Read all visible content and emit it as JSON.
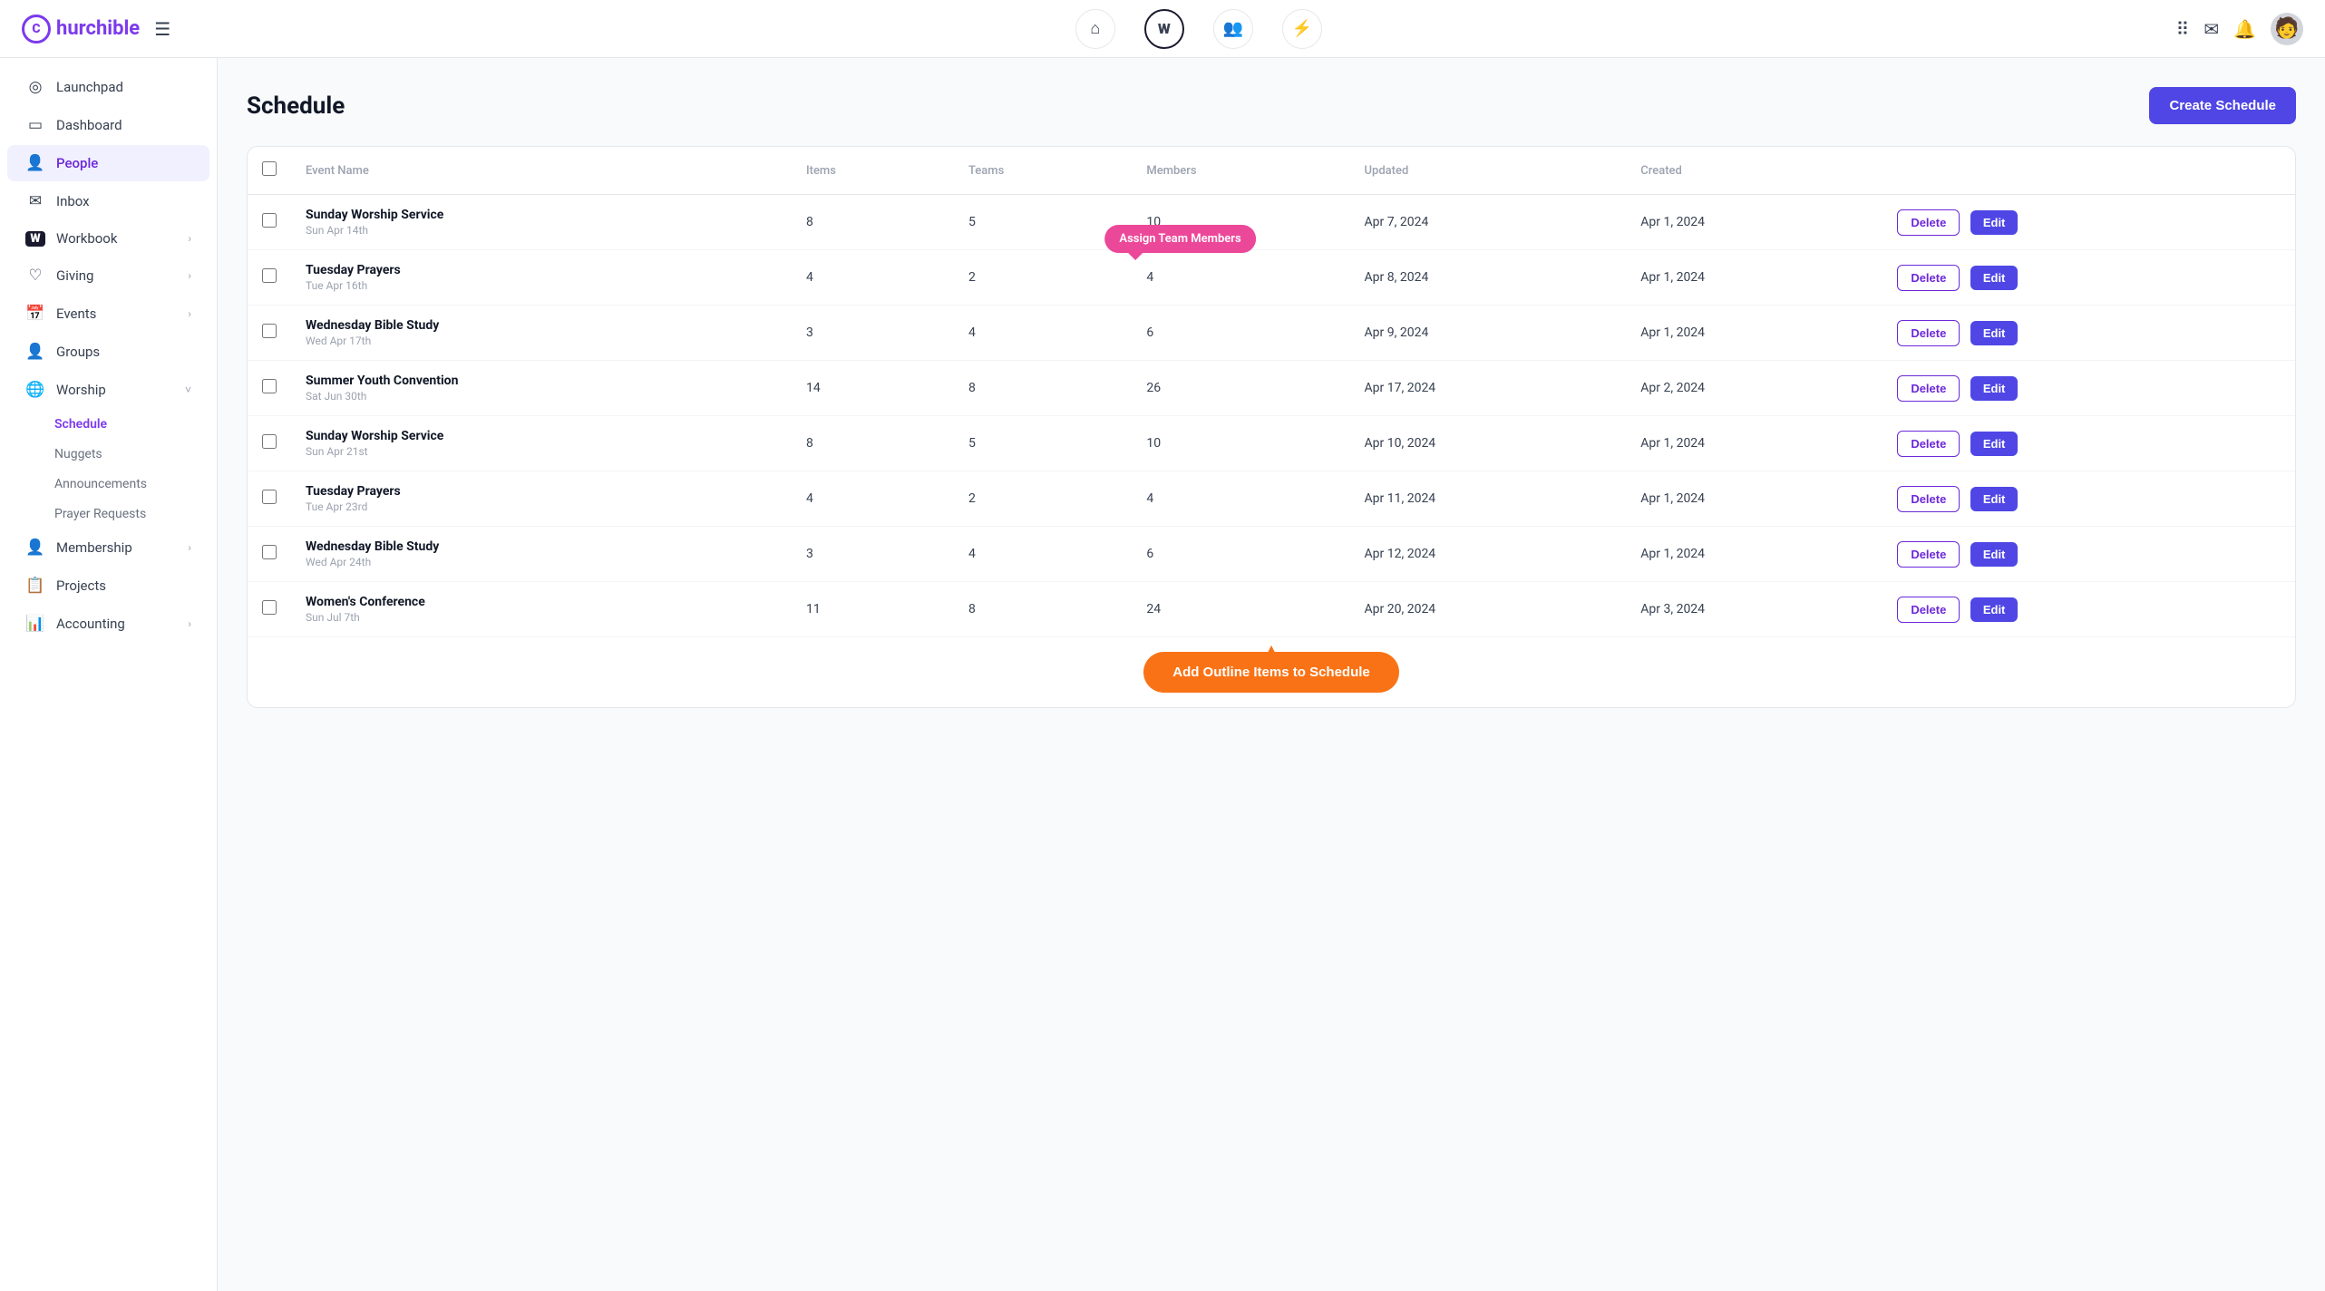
{
  "logo": {
    "letter": "C",
    "name": "hurchible"
  },
  "nav": {
    "icons": [
      {
        "id": "home",
        "symbol": "⌂",
        "label": "Home"
      },
      {
        "id": "workbook",
        "symbol": "W",
        "label": "Workbook",
        "active": true
      },
      {
        "id": "people",
        "symbol": "👥",
        "label": "People"
      },
      {
        "id": "bolt",
        "symbol": "⚡",
        "label": "Activity"
      }
    ],
    "right": [
      {
        "id": "grid",
        "symbol": "⋮⋮⋮"
      },
      {
        "id": "mail",
        "symbol": "✉"
      },
      {
        "id": "bell",
        "symbol": "🔔"
      }
    ]
  },
  "sidebar": {
    "items": [
      {
        "id": "launchpad",
        "label": "Launchpad",
        "icon": "◎",
        "expandable": false
      },
      {
        "id": "dashboard",
        "label": "Dashboard",
        "icon": "▭",
        "expandable": false
      },
      {
        "id": "people",
        "label": "People",
        "icon": "👤",
        "expandable": false,
        "active": true
      },
      {
        "id": "inbox",
        "label": "Inbox",
        "icon": "✉",
        "expandable": false
      },
      {
        "id": "workbook",
        "label": "Workbook",
        "icon": "W",
        "expandable": true
      },
      {
        "id": "giving",
        "label": "Giving",
        "icon": "♡",
        "expandable": true
      },
      {
        "id": "events",
        "label": "Events",
        "icon": "📅",
        "expandable": true
      },
      {
        "id": "groups",
        "label": "Groups",
        "icon": "👤",
        "expandable": false
      },
      {
        "id": "worship",
        "label": "Worship",
        "icon": "🌐",
        "expandable": true,
        "expanded": true
      },
      {
        "id": "membership",
        "label": "Membership",
        "icon": "👤+",
        "expandable": true
      },
      {
        "id": "projects",
        "label": "Projects",
        "icon": "📋",
        "expandable": false
      },
      {
        "id": "accounting",
        "label": "Accounting",
        "icon": "📊",
        "expandable": true
      }
    ],
    "worship_sub": [
      {
        "id": "schedule",
        "label": "Schedule",
        "active": true
      },
      {
        "id": "nuggets",
        "label": "Nuggets"
      },
      {
        "id": "announcements",
        "label": "Announcements"
      },
      {
        "id": "prayer-requests",
        "label": "Prayer Requests"
      }
    ]
  },
  "page": {
    "title": "Schedule",
    "create_button": "Create Schedule"
  },
  "table": {
    "columns": [
      "",
      "Event Name",
      "Items",
      "Teams",
      "Members",
      "Updated",
      "Created",
      ""
    ],
    "rows": [
      {
        "id": 1,
        "name": "Sunday Worship Service",
        "date": "Sun Apr 14th",
        "items": 8,
        "teams": 5,
        "members": 10,
        "updated": "Apr 7, 2024",
        "created": "Apr 1, 2024",
        "tooltip": null
      },
      {
        "id": 2,
        "name": "Tuesday Prayers",
        "date": "Tue Apr 16th",
        "items": 4,
        "teams": 2,
        "members": 4,
        "updated": "Apr 8, 2024",
        "created": "Apr 1, 2024",
        "tooltip": "Assign Team Members"
      },
      {
        "id": 3,
        "name": "Wednesday Bible Study",
        "date": "Wed Apr 17th",
        "items": 3,
        "teams": 4,
        "members": 6,
        "updated": "Apr 9, 2024",
        "created": "Apr 1, 2024",
        "tooltip": null
      },
      {
        "id": 4,
        "name": "Summer Youth Convention",
        "date": "Sat Jun 30th",
        "items": 14,
        "teams": 8,
        "members": 26,
        "updated": "Apr 17, 2024",
        "created": "Apr 2, 2024",
        "tooltip": null
      },
      {
        "id": 5,
        "name": "Sunday Worship Service",
        "date": "Sun Apr 21st",
        "items": 8,
        "teams": 5,
        "members": 10,
        "updated": "Apr 10, 2024",
        "created": "Apr 1, 2024",
        "tooltip": null
      },
      {
        "id": 6,
        "name": "Tuesday Prayers",
        "date": "Tue Apr 23rd",
        "items": 4,
        "teams": 2,
        "members": 4,
        "updated": "Apr 11, 2024",
        "created": "Apr 1, 2024",
        "tooltip": null
      },
      {
        "id": 7,
        "name": "Wednesday Bible Study",
        "date": "Wed Apr 24th",
        "items": 3,
        "teams": 4,
        "members": 6,
        "updated": "Apr 12, 2024",
        "created": "Apr 1, 2024",
        "tooltip": null
      },
      {
        "id": 8,
        "name": "Women's Conference",
        "date": "Sun Jul 7th",
        "items": 11,
        "teams": 8,
        "members": 24,
        "updated": "Apr 20, 2024",
        "created": "Apr 3, 2024",
        "tooltip": null
      }
    ],
    "delete_label": "Delete",
    "edit_label": "Edit"
  },
  "add_outline_button": "Add Outline Items to Schedule"
}
